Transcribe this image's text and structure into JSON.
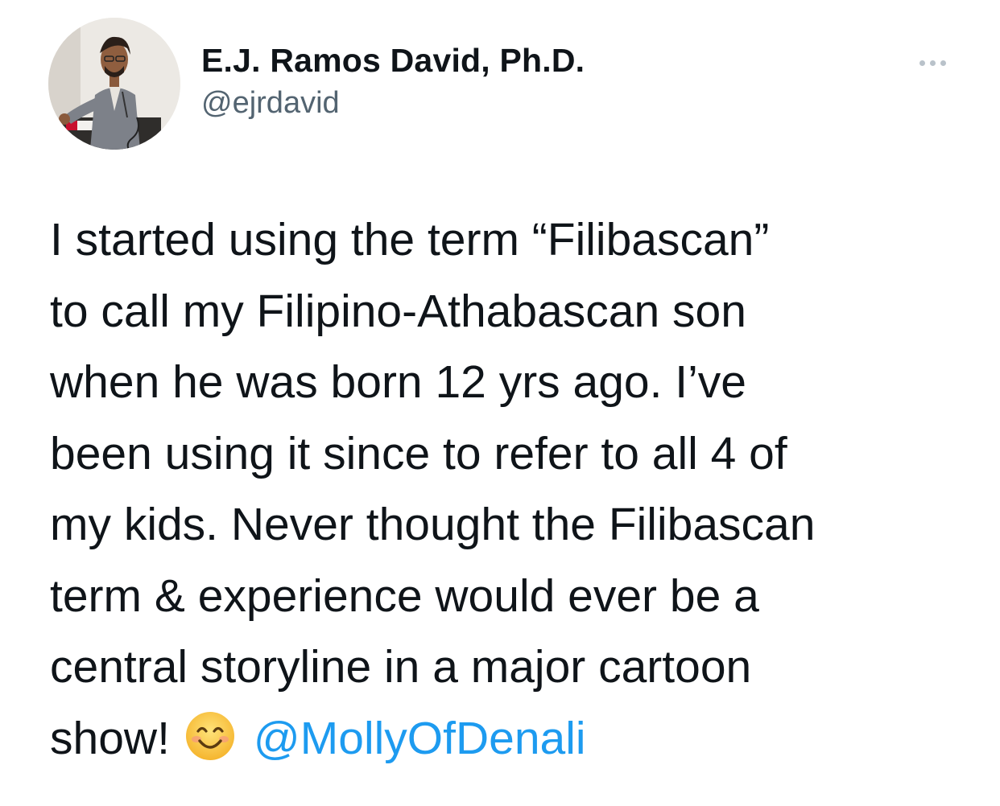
{
  "author": {
    "display_name": "E.J. Ramos David, Ph.D.",
    "handle": "@ejrdavid",
    "avatar_icon": "profile-photo"
  },
  "more_icon": "more-dots-icon",
  "tweet": {
    "lines": [
      "I started using the term “Filibascan”",
      "to call my Filipino-Athabascan son",
      "when he was born 12 yrs ago. I’ve",
      "been using it since to refer to all 4 of",
      "my kids. Never thought the Filibascan",
      "term & experience would ever be a",
      "central storyline in a major cartoon"
    ],
    "last_line_text": "show!",
    "emoji": "smiling-face-with-smiling-eyes-emoji",
    "mention": "@MollyOfDenali"
  },
  "colors": {
    "text": "#0f1419",
    "secondary": "#536471",
    "link": "#1d9bf0",
    "background": "#ffffff"
  }
}
